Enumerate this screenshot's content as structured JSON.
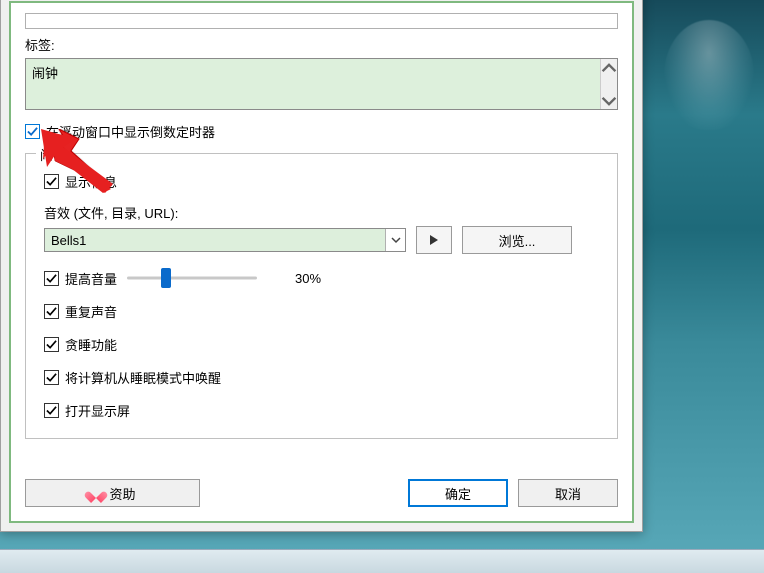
{
  "labels": {
    "tag_label": "标签:",
    "tag_value": "闹钟",
    "float_checkbox": "在浮动窗口中显示倒数定时器",
    "fieldset_legend": "闹钟",
    "show_message": "显示信息",
    "sound_label": "音效 (文件, 目录, URL):",
    "sound_value": "Bells1",
    "browse": "浏览...",
    "boost_volume": "提高音量",
    "volume_pct": "30%",
    "repeat_sound": "重复声音",
    "snooze": "贪睡功能",
    "wake_pc": "将计算机从睡眠模式中唤醒",
    "turn_on_display": "打开显示屏",
    "sponsor": "资助",
    "ok": "确定",
    "cancel": "取消"
  },
  "volume_slider_percent": 30
}
